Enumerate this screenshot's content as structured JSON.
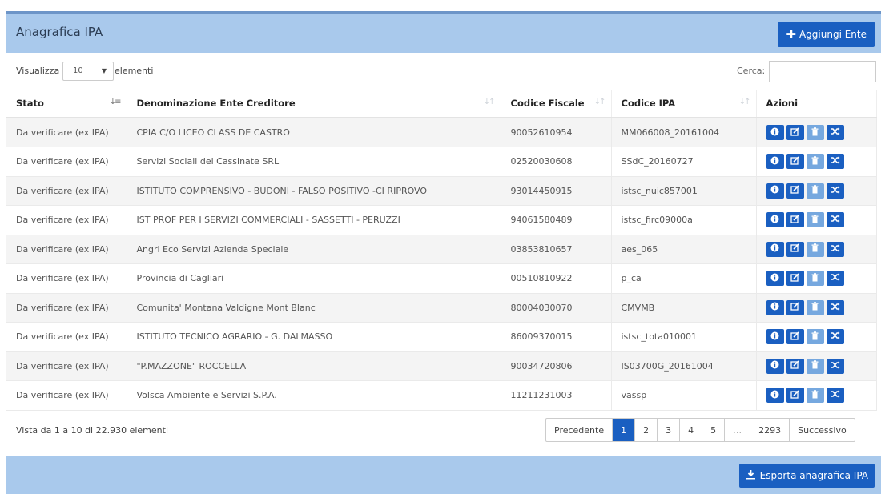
{
  "header": {
    "title": "Anagrafica IPA",
    "add_button": "Aggiungi Ente"
  },
  "controls": {
    "show_label": "Visualizza",
    "page_size": "10",
    "show_after": "elementi",
    "search_label": "Cerca:",
    "search_value": ""
  },
  "table": {
    "columns": [
      "Stato",
      "Denominazione Ente Creditore",
      "Codice Fiscale",
      "Codice IPA",
      "Azioni"
    ],
    "rows": [
      {
        "stato": "Da verificare (ex IPA)",
        "denominazione": "CPIA C/O LICEO CLASS DE CASTRO",
        "codice_fiscale": "90052610954",
        "codice_ipa": "MM066008_20161004"
      },
      {
        "stato": "Da verificare (ex IPA)",
        "denominazione": "Servizi Sociali del Cassinate SRL",
        "codice_fiscale": "02520030608",
        "codice_ipa": "SSdC_20160727"
      },
      {
        "stato": "Da verificare (ex IPA)",
        "denominazione": "ISTITUTO COMPRENSIVO - BUDONI - FALSO POSITIVO -CI RIPROVO",
        "codice_fiscale": "93014450915",
        "codice_ipa": "istsc_nuic857001"
      },
      {
        "stato": "Da verificare (ex IPA)",
        "denominazione": "IST PROF PER I SERVIZI COMMERCIALI - SASSETTI - PERUZZI",
        "codice_fiscale": "94061580489",
        "codice_ipa": "istsc_firc09000a"
      },
      {
        "stato": "Da verificare (ex IPA)",
        "denominazione": "Angri Eco Servizi Azienda Speciale",
        "codice_fiscale": "03853810657",
        "codice_ipa": "aes_065"
      },
      {
        "stato": "Da verificare (ex IPA)",
        "denominazione": "Provincia di Cagliari",
        "codice_fiscale": "00510810922",
        "codice_ipa": "p_ca"
      },
      {
        "stato": "Da verificare (ex IPA)",
        "denominazione": "Comunita' Montana Valdigne Mont Blanc",
        "codice_fiscale": "80004030070",
        "codice_ipa": "CMVMB"
      },
      {
        "stato": "Da verificare (ex IPA)",
        "denominazione": "ISTITUTO TECNICO AGRARIO - G. DALMASSO",
        "codice_fiscale": "86009370015",
        "codice_ipa": "istsc_tota010001"
      },
      {
        "stato": "Da verificare (ex IPA)",
        "denominazione": "\"P.MAZZONE\" ROCCELLA",
        "codice_fiscale": "90034720806",
        "codice_ipa": "IS03700G_20161004"
      },
      {
        "stato": "Da verificare (ex IPA)",
        "denominazione": "Volsca Ambiente e Servizi S.P.A.",
        "codice_fiscale": "11211231003",
        "codice_ipa": "vassp"
      }
    ],
    "row_actions": [
      "info-icon",
      "edit-icon",
      "trash-icon",
      "shuffle-icon"
    ]
  },
  "footer": {
    "info": "Vista da 1 a 10 di 22.930 elementi",
    "pagination": {
      "prev": "Precedente",
      "pages": [
        "1",
        "2",
        "3",
        "4",
        "5",
        "…",
        "2293"
      ],
      "active": "1",
      "next": "Successivo"
    },
    "export_button": "Esporta anagrafica IPA"
  },
  "colors": {
    "primary": "#1a5fc1",
    "panel": "#a9c9ec",
    "action_light": "#76a8df"
  }
}
